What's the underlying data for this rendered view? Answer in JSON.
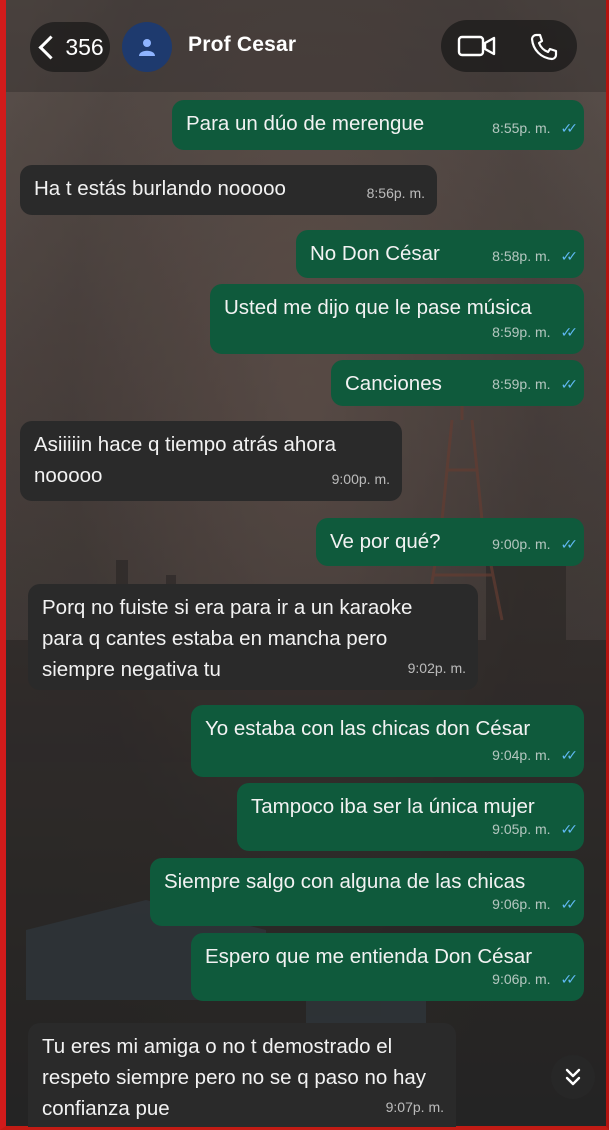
{
  "header": {
    "back_count": "356",
    "contact_name": "Prof Cesar"
  },
  "icons": {
    "back": "chevron-left-icon",
    "avatar": "person-icon",
    "video": "video-camera-icon",
    "phone": "phone-icon",
    "scroll": "double-chevron-down-icon"
  },
  "colors": {
    "outgoing_bubble": "#0f5a3c",
    "incoming_bubble": "#2a2a2a",
    "read_ticks": "#5fb8f2",
    "avatar_bg": "#1e3a6e"
  },
  "messages": [
    {
      "dir": "out",
      "text": "Para un dúo de merengue",
      "time": "8:55p. m.",
      "read": true
    },
    {
      "dir": "in",
      "text": "Ha t estás burlando nooooo",
      "time": "8:56p. m."
    },
    {
      "dir": "out",
      "text": "No Don César",
      "time": "8:58p. m.",
      "read": true
    },
    {
      "dir": "out",
      "text": "Usted me dijo que le pase música",
      "time": "8:59p. m.",
      "read": true
    },
    {
      "dir": "out",
      "text": "Canciones",
      "time": "8:59p. m.",
      "read": true
    },
    {
      "dir": "in",
      "text": "Asiiiiin hace q tiempo atrás ahora nooooo",
      "time": "9:00p. m."
    },
    {
      "dir": "out",
      "text": "Ve por qué?",
      "time": "9:00p. m.",
      "read": true
    },
    {
      "dir": "in",
      "text": "Porq no fuiste si era para ir a un karaoke para q cantes estaba en mancha pero siempre negativa tu",
      "time": "9:02p. m."
    },
    {
      "dir": "out",
      "text": "Yo estaba con las chicas don César",
      "time": "9:04p. m.",
      "read": true
    },
    {
      "dir": "out",
      "text": "Tampoco iba ser la única mujer",
      "time": "9:05p. m.",
      "read": true
    },
    {
      "dir": "out",
      "text": "Siempre salgo con alguna de las chicas",
      "time": "9:06p. m.",
      "read": true
    },
    {
      "dir": "out",
      "text": "Espero que me entienda Don César",
      "time": "9:06p. m.",
      "read": true
    },
    {
      "dir": "in",
      "text": "Tu eres mi amiga o no t demostrado el respeto siempre pero no se q paso no hay confianza pue",
      "time": "9:07p. m."
    }
  ]
}
